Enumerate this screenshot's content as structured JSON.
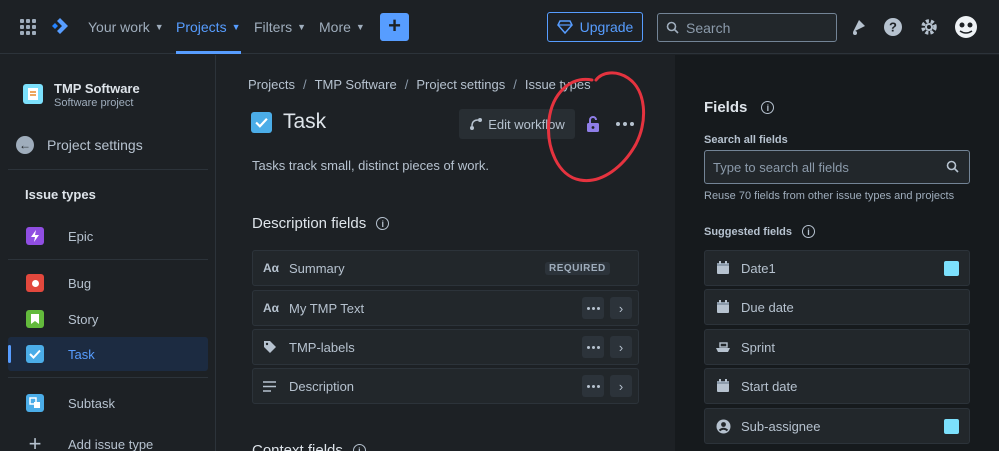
{
  "nav": {
    "items": [
      {
        "label": "Your work",
        "active": false
      },
      {
        "label": "Projects",
        "active": true
      },
      {
        "label": "Filters",
        "active": false
      },
      {
        "label": "More",
        "active": false
      }
    ],
    "create_label": "+",
    "upgrade_label": "Upgrade",
    "search_placeholder": "Search"
  },
  "sidebar": {
    "project_name": "TMP Software",
    "project_type": "Software project",
    "back_label": "Project settings",
    "heading": "Issue types",
    "items": [
      {
        "label": "Epic",
        "icon": "epic-icon",
        "color": "#904ee2"
      },
      {
        "label": "Bug",
        "icon": "bug-icon",
        "color": "#e2483d"
      },
      {
        "label": "Story",
        "icon": "story-icon",
        "color": "#63ba3c"
      },
      {
        "label": "Task",
        "icon": "task-icon",
        "color": "#4bade8",
        "active": true
      },
      {
        "label": "Subtask",
        "icon": "subtask-icon",
        "color": "#4bade8"
      },
      {
        "label": "Add issue type",
        "icon": "plus-icon"
      }
    ]
  },
  "main": {
    "breadcrumbs": [
      "Projects",
      "TMP Software",
      "Project settings",
      "Issue types"
    ],
    "title": "Task",
    "edit_workflow_label": "Edit workflow",
    "description": "Tasks track small, distinct pieces of work.",
    "description_fields_title": "Description fields",
    "context_fields_title": "Context fields",
    "fields": [
      {
        "label": "Summary",
        "icon": "Aa",
        "badge": "REQUIRED"
      },
      {
        "label": "My TMP Text",
        "icon": "Aa"
      },
      {
        "label": "TMP-labels",
        "icon": "tag"
      },
      {
        "label": "Description",
        "icon": "lines"
      }
    ]
  },
  "right_panel": {
    "title": "Fields",
    "search_label": "Search all fields",
    "search_placeholder": "Type to search all fields",
    "hint": "Reuse 70 fields from other issue types and projects",
    "suggested_label": "Suggested fields",
    "suggested": [
      {
        "label": "Date1",
        "icon": "calendar-icon",
        "project_badge": true
      },
      {
        "label": "Due date",
        "icon": "calendar-icon"
      },
      {
        "label": "Sprint",
        "icon": "sprint-icon"
      },
      {
        "label": "Start date",
        "icon": "calendar-icon"
      },
      {
        "label": "Sub-assignee",
        "icon": "user-icon",
        "project_badge": true
      }
    ]
  },
  "colors": {
    "accent": "#579dff",
    "background": "#1d2125",
    "annotation": "#e5333f"
  }
}
